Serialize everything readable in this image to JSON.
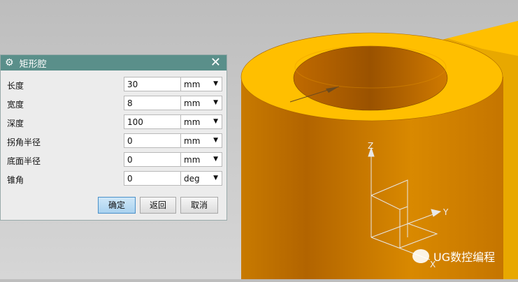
{
  "dialog": {
    "title": "矩形腔",
    "fields": [
      {
        "label": "长度",
        "value": "30",
        "unit": "mm"
      },
      {
        "label": "宽度",
        "value": "8",
        "unit": "mm"
      },
      {
        "label": "深度",
        "value": "100",
        "unit": "mm"
      },
      {
        "label": "拐角半径",
        "value": "0",
        "unit": "mm"
      },
      {
        "label": "底面半径",
        "value": "0",
        "unit": "mm"
      },
      {
        "label": "锥角",
        "value": "0",
        "unit": "deg"
      }
    ],
    "buttons": {
      "ok": "确定",
      "back": "返回",
      "cancel": "取消"
    }
  },
  "viewport": {
    "axis_z": "Z",
    "axis_y": "Y",
    "axis_x": "X",
    "model_color": "#f0a800"
  },
  "watermark": {
    "text": "UG数控编程"
  }
}
